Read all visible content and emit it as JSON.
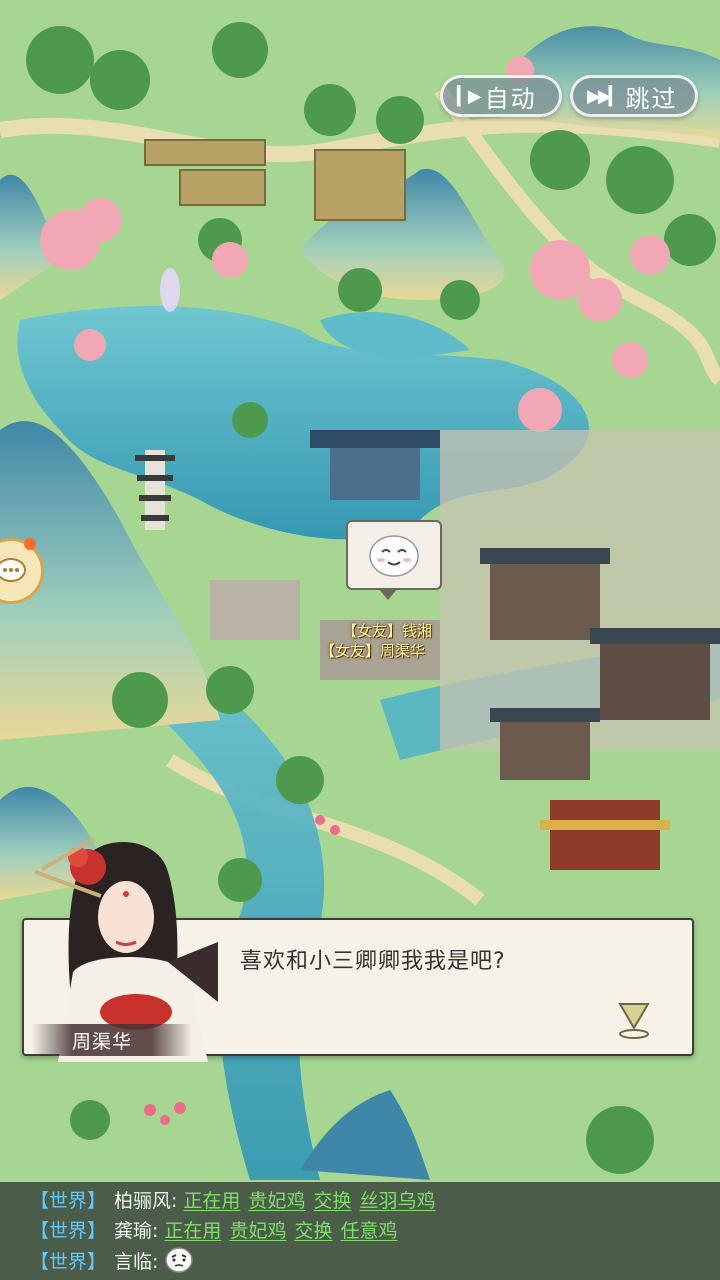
{
  "controls": {
    "auto_label": "自动",
    "skip_label": "跳过"
  },
  "map": {
    "npc_tags": [
      "【女友】钱湘",
      "【女友】周渠华"
    ]
  },
  "dialog": {
    "text": "喜欢和小三卿卿我我是吧?",
    "speaker": "周渠华"
  },
  "chat": {
    "lines": [
      {
        "channel": "【世界】",
        "user": "柏骊风:",
        "parts": [
          "正在用",
          "贵妃鸡",
          "交换",
          "丝羽乌鸡"
        ]
      },
      {
        "channel": "【世界】",
        "user": "龚瑜:",
        "parts": [
          "正在用",
          "贵妃鸡",
          "交换",
          "任意鸡"
        ]
      },
      {
        "channel": "【世界】",
        "user": "言临:",
        "emoji": "thinking-face-icon"
      }
    ]
  },
  "colors": {
    "channel": "#5ec9ff",
    "link": "#7ee06a",
    "water": "#4fb3c8",
    "grass": "#9fd08e"
  }
}
